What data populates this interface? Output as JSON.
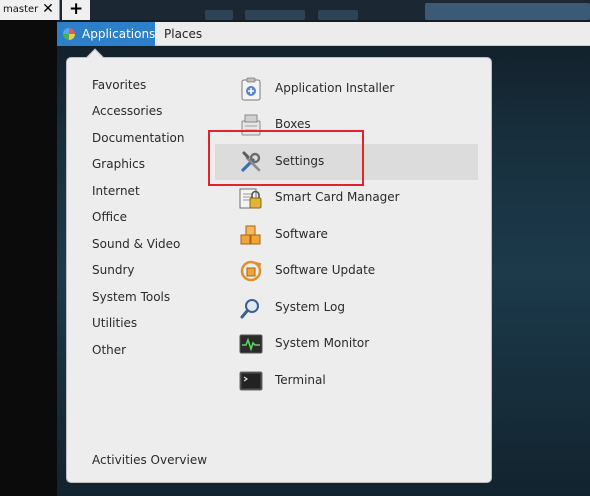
{
  "tabbar": {
    "tab_label": "master",
    "close_glyph": "✕",
    "add_glyph": "+"
  },
  "top_panel": {
    "applications_label": "Applications",
    "places_label": "Places"
  },
  "categories": [
    "Favorites",
    "Accessories",
    "Documentation",
    "Graphics",
    "Internet",
    "Office",
    "Sound & Video",
    "Sundry",
    "System Tools",
    "Utilities",
    "Other"
  ],
  "activities_overview": "Activities Overview",
  "apps": [
    {
      "label": "Application Installer",
      "icon": "installer-icon"
    },
    {
      "label": "Boxes",
      "icon": "boxes-icon"
    },
    {
      "label": "Settings",
      "icon": "settings-icon",
      "hovered": true
    },
    {
      "label": "Smart Card Manager",
      "icon": "smart-card-icon"
    },
    {
      "label": "Software",
      "icon": "software-icon"
    },
    {
      "label": "Software Update",
      "icon": "software-update-icon"
    },
    {
      "label": "System Log",
      "icon": "system-log-icon"
    },
    {
      "label": "System Monitor",
      "icon": "system-monitor-icon"
    },
    {
      "label": "Terminal",
      "icon": "terminal-icon"
    }
  ],
  "colors": {
    "accent": "#2e7fc9",
    "highlight_box": "#e3222b",
    "menu_bg": "#ededed"
  }
}
